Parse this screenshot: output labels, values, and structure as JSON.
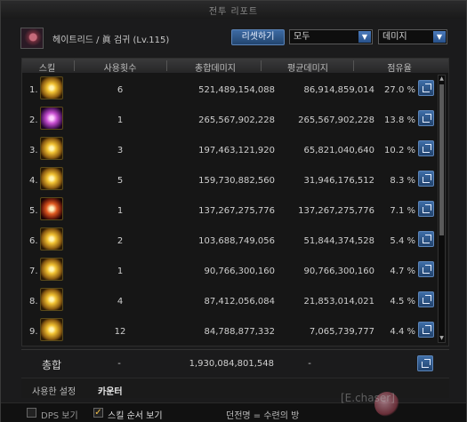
{
  "window": {
    "title": "전투 리포트"
  },
  "character": {
    "name": "헤이트리드 / 眞 검귀 (Lv.115)"
  },
  "toolbar": {
    "reset_label": "리셋하기",
    "filter1": "모두",
    "filter2": "데미지"
  },
  "table": {
    "headers": [
      "스킬",
      "사용횟수",
      "총합데미지",
      "평균데미지",
      "점유율"
    ],
    "rows": [
      {
        "rank": "1.",
        "icon": "gold-slash-icon",
        "uses": "6",
        "total": "521,489,154,088",
        "avg": "86,914,859,014",
        "share": "27.0 %"
      },
      {
        "rank": "2.",
        "icon": "purple-cross-slash-icon",
        "uses": "1",
        "total": "265,567,902,228",
        "avg": "265,567,902,228",
        "share": "13.8 %"
      },
      {
        "rank": "3.",
        "icon": "gold-wave-icon",
        "uses": "3",
        "total": "197,463,121,920",
        "avg": "65,821,040,640",
        "share": "10.2 %"
      },
      {
        "rank": "4.",
        "icon": "gold-blade-icon",
        "uses": "5",
        "total": "159,730,882,560",
        "avg": "31,946,176,512",
        "share": "8.3 %"
      },
      {
        "rank": "5.",
        "icon": "red-burst-icon",
        "uses": "1",
        "total": "137,267,275,776",
        "avg": "137,267,275,776",
        "share": "7.1 %"
      },
      {
        "rank": "6.",
        "icon": "gold-swirl-icon",
        "uses": "2",
        "total": "103,688,749,056",
        "avg": "51,844,374,528",
        "share": "5.4 %"
      },
      {
        "rank": "7.",
        "icon": "gold-rune-icon",
        "uses": "1",
        "total": "90,766,300,160",
        "avg": "90,766,300,160",
        "share": "4.7 %"
      },
      {
        "rank": "8.",
        "icon": "gold-arc-icon",
        "uses": "4",
        "total": "87,412,056,084",
        "avg": "21,853,014,021",
        "share": "4.5 %"
      },
      {
        "rank": "9.",
        "icon": "gold-flash-icon",
        "uses": "12",
        "total": "84,788,877,332",
        "avg": "7,065,739,777",
        "share": "4.4 %"
      }
    ],
    "summary": {
      "label": "총합",
      "uses": "-",
      "total": "1,930,084,801,548",
      "avg": "-"
    }
  },
  "settings": {
    "label": "사용한 설정",
    "value": "카운터"
  },
  "footer": {
    "dps_label": "DPS 보기",
    "dps_checked": false,
    "order_label": "스킬 순서 보기",
    "order_checked": true,
    "dungeon": "던전명 = 수련의 방"
  },
  "watermark": {
    "text": "[E.chaser]"
  }
}
